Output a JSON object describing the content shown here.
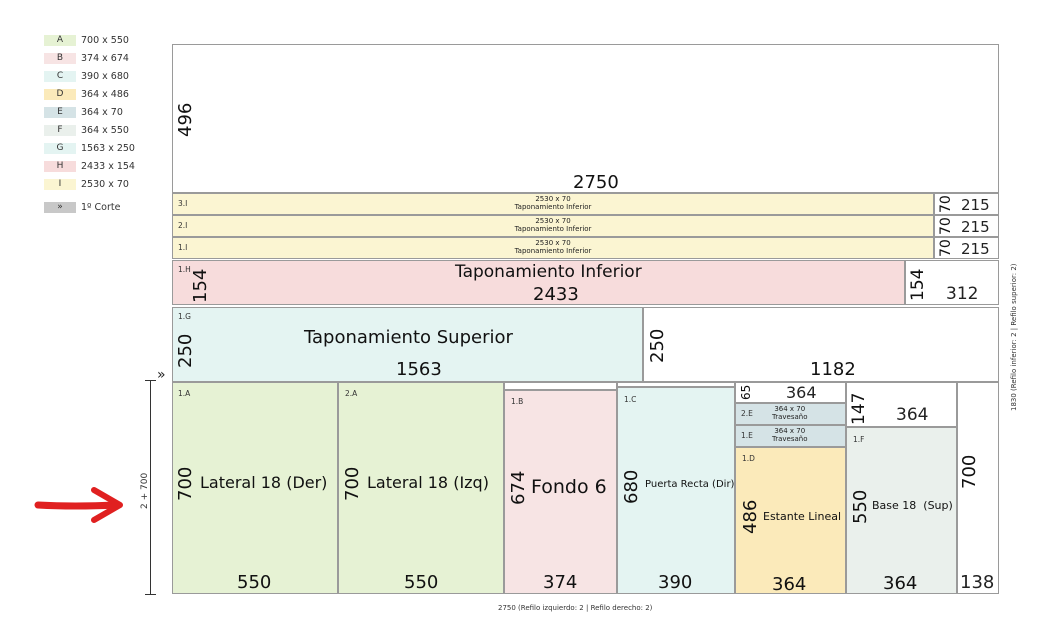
{
  "legend": [
    {
      "letter": "A",
      "size": "700 x 550",
      "color": "#e6f2d4"
    },
    {
      "letter": "B",
      "size": "374 x 674",
      "color": "#f7e4e4"
    },
    {
      "letter": "C",
      "size": "390 x 680",
      "color": "#e4f4f2"
    },
    {
      "letter": "D",
      "size": "364 x 486",
      "color": "#fbeaba"
    },
    {
      "letter": "E",
      "size": "364 x 70",
      "color": "#d5e3e6"
    },
    {
      "letter": "F",
      "size": "364 x 550",
      "color": "#eaf0ec"
    },
    {
      "letter": "G",
      "size": "1563 x 250",
      "color": "#e4f4f2"
    },
    {
      "letter": "H",
      "size": "2433 x 154",
      "color": "#f7dcdc"
    },
    {
      "letter": "I",
      "size": "2530 x 70",
      "color": "#fbf5d2"
    }
  ],
  "legend_cut": {
    "symbol": "»",
    "label": "1º Corte",
    "color": "#c8c8c8"
  },
  "colors": {
    "A": "#e6f2d4",
    "B": "#f7e4e4",
    "C": "#e4f4f2",
    "D": "#fbeaba",
    "E": "#d5e3e6",
    "F": "#eaf0ec",
    "G": "#e4f4f2",
    "H": "#f7dcdc",
    "I": "#fbf5d2",
    "arrow": "#e02020"
  },
  "board": {
    "top_waste": {
      "height": "496",
      "width": "2750"
    },
    "strips_I": [
      {
        "id": "3.I",
        "size": "2530 x 70",
        "name": "Taponamiento Inferior",
        "side_h": "70",
        "side_w": "215"
      },
      {
        "id": "2.I",
        "size": "2530 x 70",
        "name": "Taponamiento Inferior",
        "side_h": "70",
        "side_w": "215"
      },
      {
        "id": "1.I",
        "size": "2530 x 70",
        "name": "Taponamiento Inferior",
        "side_h": "70",
        "side_w": "215"
      }
    ],
    "strip_H": {
      "id": "1.H",
      "height": "154",
      "name": "Taponamiento Inferior",
      "width": "2433",
      "waste_h": "154",
      "waste_w": "312"
    },
    "strip_G": {
      "id": "1.G",
      "height": "250",
      "name": "Taponamiento Superior",
      "width": "1563",
      "waste_h": "250",
      "waste_w": "1182"
    },
    "bottom": {
      "A1": {
        "id": "1.A",
        "h": "700",
        "name": "Lateral 18 (Der)",
        "w": "550"
      },
      "A2": {
        "id": "2.A",
        "h": "700",
        "name": "Lateral 18 (Izq)",
        "w": "550"
      },
      "B": {
        "id": "1.B",
        "h": "674",
        "name": "Fondo 6",
        "w": "374"
      },
      "C": {
        "id": "1.C",
        "h": "680",
        "name": "Puerta Recta (Dir)",
        "w": "390"
      },
      "E_top": {
        "h": "65",
        "w": "364"
      },
      "E2": {
        "id": "2.E",
        "size": "364 x 70",
        "name": "Travesaño"
      },
      "E1": {
        "id": "1.E",
        "size": "364 x 70",
        "name": "Travesaño"
      },
      "D": {
        "id": "1.D",
        "h": "486",
        "name": "Estante Lineal",
        "w": "364"
      },
      "F_top": {
        "h": "147",
        "w": "364"
      },
      "F": {
        "id": "1.F",
        "h": "550",
        "name": "Base 18  (Sup)",
        "w": "364"
      },
      "waste": {
        "h": "700",
        "w": "138"
      }
    }
  },
  "notes": {
    "bottom": "2750 (Refilo izquierdo: 2  | Refilo derecho: 2)",
    "right": "1830 (Refilo inferior: 2 | Refilo superior: 2)",
    "left_dim": "2 + 700",
    "cut_marker": "»"
  }
}
